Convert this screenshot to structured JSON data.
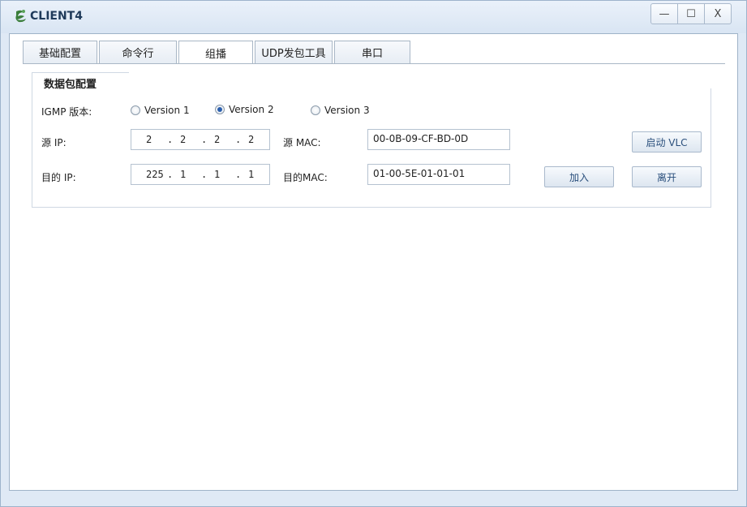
{
  "window": {
    "title": "CLIENT4",
    "controls": {
      "minimize": "—",
      "maximize": "☐",
      "close": "X"
    }
  },
  "tabs": [
    {
      "label": "基础配置"
    },
    {
      "label": "命令行"
    },
    {
      "label": "组播"
    },
    {
      "label": "UDP发包工具"
    },
    {
      "label": "串口"
    }
  ],
  "group": {
    "title": "数据包配置",
    "igmp_label": "IGMP 版本:",
    "versions": [
      {
        "label": "Version 1",
        "selected": false
      },
      {
        "label": "Version 2",
        "selected": true
      },
      {
        "label": "Version 3",
        "selected": false
      }
    ],
    "src_ip_label": "源 IP:",
    "src_ip": [
      "2",
      "2",
      "2",
      "2"
    ],
    "src_mac_label": "源  MAC:",
    "src_mac": "00-0B-09-CF-BD-0D",
    "dst_ip_label": "目的 IP:",
    "dst_ip": [
      "225",
      "1",
      "1",
      "1"
    ],
    "dst_mac_label": "目的MAC:",
    "dst_mac": "01-00-5E-01-01-01",
    "ip_separator": ".",
    "buttons": {
      "start_vlc": "启动 VLC",
      "join": "加入",
      "leave": "离开"
    }
  }
}
